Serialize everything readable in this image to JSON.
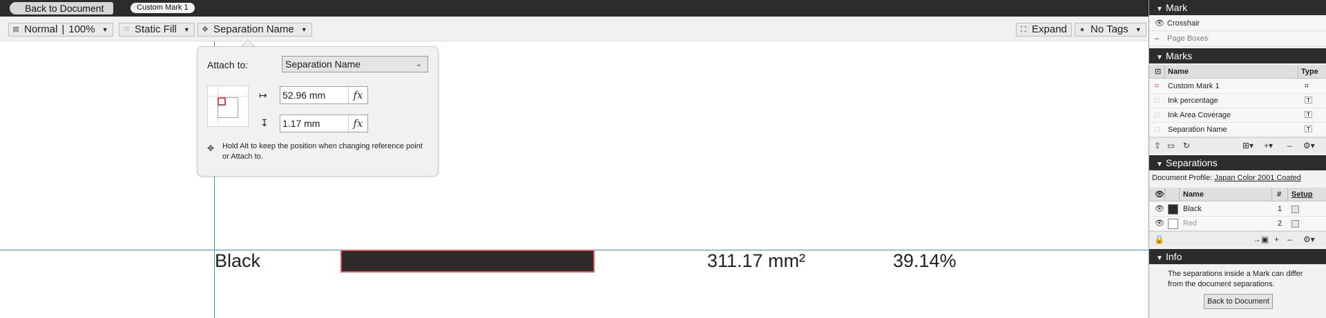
{
  "topbar": {
    "back_label": "Back to Document",
    "mark_label": "Custom Mark 1"
  },
  "toolbar": {
    "view_mode": "Normal",
    "zoom": "100%",
    "fill_mode": "Static Fill",
    "attach_target": "Separation Name",
    "expand_label": "Expand",
    "tags_label": "No Tags",
    "separator": "|"
  },
  "popup": {
    "attach_label": "Attach to:",
    "attach_value": "Separation Name",
    "x_value": "52.96 mm",
    "y_value": "1.17 mm",
    "fx_label": "fx",
    "hint": "Hold Alt to keep the position when changing reference point or Attach to."
  },
  "canvas": {
    "separation_name": "Black",
    "area": "311.17 mm²",
    "coverage": "39.14%",
    "bar_color": "#2e2a28",
    "guide_color": "#3d8fd6"
  },
  "panel": {
    "mark_header": "Mark",
    "mark_items": [
      "Crosshair",
      "Page Boxes"
    ],
    "marks_header": "Marks",
    "marks_columns": {
      "name": "Name",
      "type": "Type"
    },
    "marks_rows": [
      "Custom Mark 1",
      "Ink percentage",
      "Ink Area Coverage",
      "Separation Name"
    ],
    "separations_header": "Separations",
    "doc_profile_label": "Document Profile:",
    "doc_profile_value": "Japan Color 2001 Coated",
    "sep_columns": {
      "name": "Name",
      "num": "#",
      "setup": "Setup"
    },
    "sep_rows": [
      {
        "name": "Black",
        "num": "1",
        "color": "#2e2a28"
      },
      {
        "name": "Red",
        "num": "2",
        "color": "#ffffff"
      }
    ],
    "info_header": "Info",
    "info_text": "The separations inside a Mark can differ from the document separations.",
    "info_button": "Back to Document"
  },
  "accent": "#e0454b"
}
